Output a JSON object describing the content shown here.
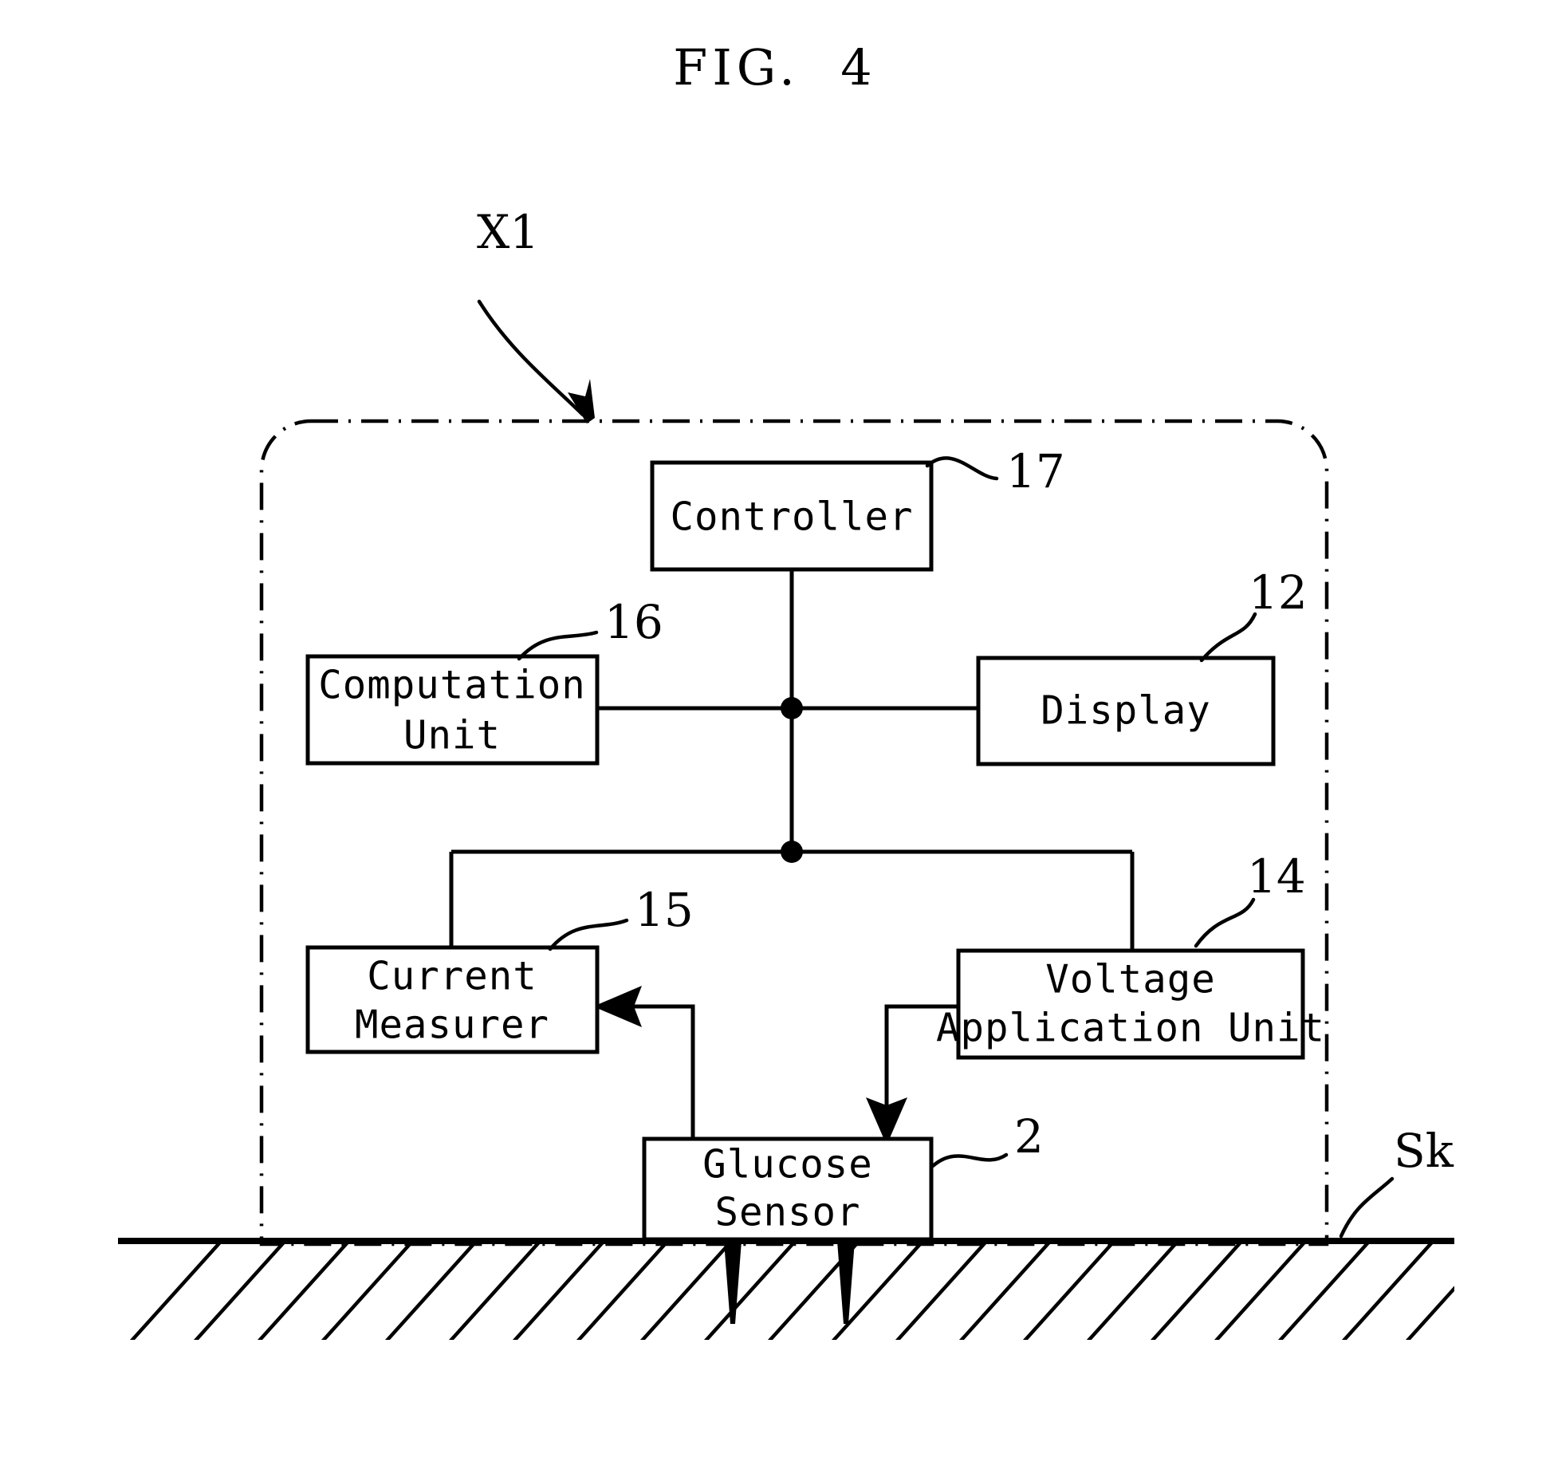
{
  "figure": {
    "title": "FIG.  4",
    "domain_note": "patent block diagram"
  },
  "labels": {
    "device_boundary": "X1",
    "skin": "Sk"
  },
  "blocks": [
    {
      "id": "controller",
      "name": "Controller",
      "ref": "17",
      "lines": [
        "Controller"
      ]
    },
    {
      "id": "computation-unit",
      "name": "Computation Unit",
      "ref": "16",
      "lines": [
        "Computation",
        "Unit"
      ]
    },
    {
      "id": "display",
      "name": "Display",
      "ref": "12",
      "lines": [
        "Display"
      ]
    },
    {
      "id": "current-measurer",
      "name": "Current Measurer",
      "ref": "15",
      "lines": [
        "Current",
        "Measurer"
      ]
    },
    {
      "id": "voltage-application-unit",
      "name": "Voltage Application Unit",
      "ref": "14",
      "lines": [
        "Voltage",
        "Application Unit"
      ]
    },
    {
      "id": "glucose-sensor",
      "name": "Glucose Sensor",
      "ref": "2",
      "lines": [
        "Glucose",
        "Sensor"
      ]
    }
  ],
  "colors": {
    "ink": "#000000",
    "paper": "#ffffff"
  }
}
